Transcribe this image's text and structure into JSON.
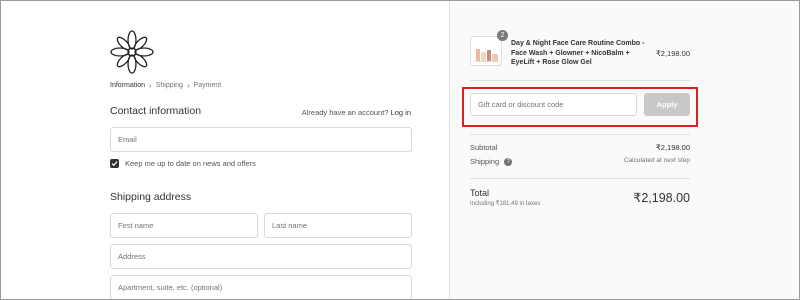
{
  "breadcrumb": {
    "items": [
      "Information",
      "Shipping",
      "Payment"
    ]
  },
  "contact": {
    "title": "Contact information",
    "account_prompt": "Already have an account?",
    "login_link": "Log in",
    "email_placeholder": "Email",
    "newsletter_label": "Keep me up to date on news and offers",
    "newsletter_checked": true
  },
  "shipping": {
    "title": "Shipping address",
    "first_name_placeholder": "First name",
    "last_name_placeholder": "Last name",
    "address_placeholder": "Address",
    "apartment_placeholder": "Apartment, suite, etc. (optional)"
  },
  "cart": {
    "product": {
      "quantity": "2",
      "name": "Day & Night Face Care Routine Combo - Face Wash + Glowner + NicoBalm + EyeLift + Rose Glow Gel",
      "price": "₹2,198.00"
    },
    "discount": {
      "placeholder": "Gift card or discount code",
      "apply_label": "Apply"
    },
    "subtotal_label": "Subtotal",
    "subtotal_value": "₹2,198.00",
    "shipping_label": "Shipping",
    "shipping_value": "Calculated at next step",
    "total_label": "Total",
    "taxes_note": "Including ₹181.49 in taxes",
    "total_value": "₹2,198.00"
  },
  "colors": {
    "highlight": "#e02020",
    "apply_disabled": "#c8c8c8",
    "checkbox": "#333333"
  }
}
